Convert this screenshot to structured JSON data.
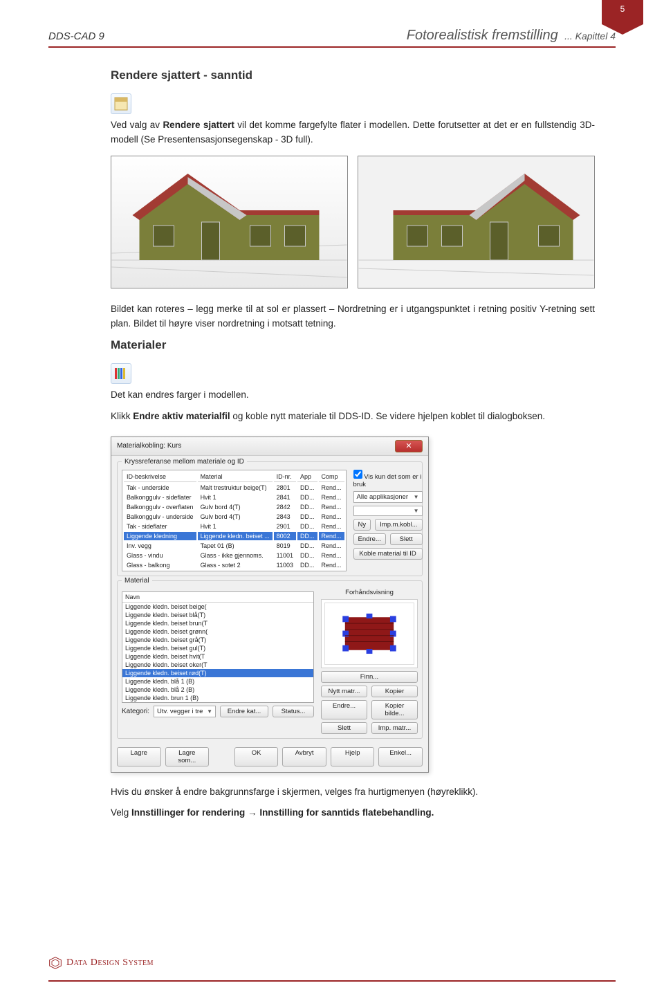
{
  "page_number": "5",
  "header": {
    "product": "DDS-CAD 9",
    "title": "Fotorealistisk fremstilling",
    "chapter": "... Kapittel 4"
  },
  "section1": {
    "heading": "Rendere sjattert -  sanntid",
    "p1a": "Ved valg av ",
    "p1b": "Rendere sjattert",
    "p1c": " vil det komme fargefylte flater i modellen. Dette forutsetter at det er en fullstendig 3D-modell (Se Presentensasjonsegenskap - 3D full).",
    "p2": "Bildet kan roteres – legg merke til at sol er plassert – Nordretning er i utgangspunktet i retning positiv Y-retning sett plan. Bildet til høyre viser nordretning i motsatt tetning."
  },
  "section2": {
    "heading": "Materialer",
    "p1": "Det kan endres farger i modellen.",
    "p2a": "Klikk ",
    "p2b": "Endre aktiv materialfil",
    "p2c": " og koble nytt materiale til DDS-ID. Se videre hjelpen koblet til dialogboksen."
  },
  "dialog": {
    "title": "Materialkobling: Kurs",
    "group1_label": "Kryssreferanse mellom materiale og ID",
    "cols": {
      "c1": "ID-beskrivelse",
      "c2": "Material",
      "c3": "ID-nr.",
      "c4": "App",
      "c5": "Comp"
    },
    "rows": [
      {
        "c1": "Tak - underside",
        "c2": "Malt trestruktur beige(T)",
        "c3": "2801",
        "c4": "DD...",
        "c5": "Rend..."
      },
      {
        "c1": "Balkonggulv - sideflater",
        "c2": "Hvit 1",
        "c3": "2841",
        "c4": "DD...",
        "c5": "Rend..."
      },
      {
        "c1": "Balkonggulv - overflaten",
        "c2": "Gulv bord 4(T)",
        "c3": "2842",
        "c4": "DD...",
        "c5": "Rend..."
      },
      {
        "c1": "Balkonggulv - underside",
        "c2": "Gulv bord 4(T)",
        "c3": "2843",
        "c4": "DD...",
        "c5": "Rend..."
      },
      {
        "c1": "Tak - sideflater",
        "c2": "Hvit 1",
        "c3": "2901",
        "c4": "DD...",
        "c5": "Rend..."
      },
      {
        "c1": "Liggende kledning",
        "c2": "Liggende kledn. beiset ...",
        "c3": "8002",
        "c4": "DD...",
        "c5": "Rend...",
        "sel": true
      },
      {
        "c1": "Inv. vegg",
        "c2": "Tapet 01 (B)",
        "c3": "8019",
        "c4": "DD...",
        "c5": "Rend..."
      },
      {
        "c1": "Glass - vindu",
        "c2": "Glass - ikke gjennoms.",
        "c3": "11001",
        "c4": "DD...",
        "c5": "Rend..."
      },
      {
        "c1": "Glass - balkong",
        "c2": "Glass - sotet 2",
        "c3": "11003",
        "c4": "DD...",
        "c5": "Rend..."
      }
    ],
    "checkbox": "Vis kun det som er i bruk",
    "combo_app": "Alle applikasjoner",
    "btn_ny": "Ny",
    "btn_imp": "Imp.m.kobl...",
    "btn_endre": "Endre...",
    "btn_slett": "Slett",
    "btn_koble": "Koble material til ID",
    "group2_label": "Material",
    "list_header": "Navn",
    "list": [
      "Liggende kledn. beiset beige(",
      "Liggende kledn. beiset blå(T)",
      "Liggende kledn. beiset brun(T",
      "Liggende kledn. beiset grønn(",
      "Liggende kledn. beiset grå(T)",
      "Liggende kledn. beiset gul(T)",
      "Liggende kledn. beiset hvit(T",
      "Liggende kledn. beiset oker(T",
      "Liggende kledn. beiset rød(T)",
      "Liggende kledn. blå 1 (B)",
      "Liggende kledn. blå 2 (B)",
      "Liggende kledn. brun 1 (B)"
    ],
    "list_sel_index": 8,
    "preview_label": "Forhåndsvisning",
    "btn_finn": "Finn...",
    "btn_nytt": "Nytt matr...",
    "btn_kopier": "Kopier",
    "btn_endre2": "Endre...",
    "btn_kopierbilde": "Kopier bilde...",
    "btn_slett2": "Slett",
    "btn_impmatr": "Imp. matr...",
    "kat_label": "Kategori:",
    "kat_value": "Utv. vegger i tre",
    "btn_endrekat": "Endre kat...",
    "btn_status": "Status...",
    "btn_lagre": "Lagre",
    "btn_lagresom": "Lagre som...",
    "btn_ok": "OK",
    "btn_avbryt": "Avbryt",
    "btn_hjelp": "Hjelp",
    "btn_enkel": "Enkel..."
  },
  "after": {
    "p1": "Hvis du ønsker å endre bakgrunnsfarge i skjermen, velges fra hurtigmenyen (høyreklikk).",
    "p2a": "Velg ",
    "p2b": "Innstillinger for rendering",
    "p2c": " → ",
    "p2d": "Innstilling for sanntids flatebehandling."
  },
  "footer": {
    "brand": "Data Design System"
  }
}
